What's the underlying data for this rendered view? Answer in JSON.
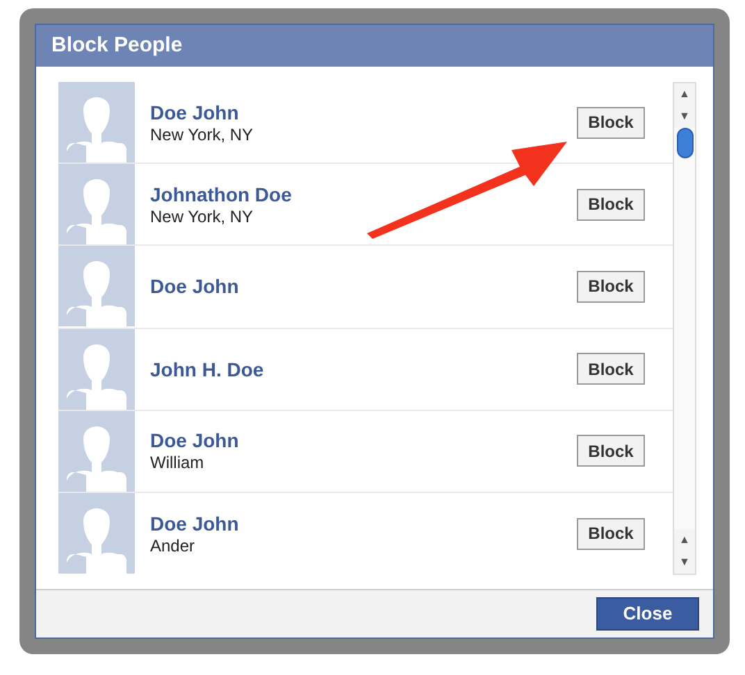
{
  "dialog": {
    "title": "Block People"
  },
  "people": [
    {
      "name": "Doe John",
      "detail": "New York, NY",
      "button": "Block"
    },
    {
      "name": "Johnathon Doe",
      "detail": "New York, NY",
      "button": "Block"
    },
    {
      "name": "Doe John",
      "button": "Block"
    },
    {
      "name": "John H. Doe",
      "button": "Block"
    },
    {
      "name": "Doe John",
      "detail": "William",
      "button": "Block"
    },
    {
      "name": "Doe John",
      "detail": "Ander",
      "button": "Block"
    }
  ],
  "scrollbar": {
    "up": "▲",
    "down": "▼"
  },
  "footer": {
    "button": "Close"
  }
}
